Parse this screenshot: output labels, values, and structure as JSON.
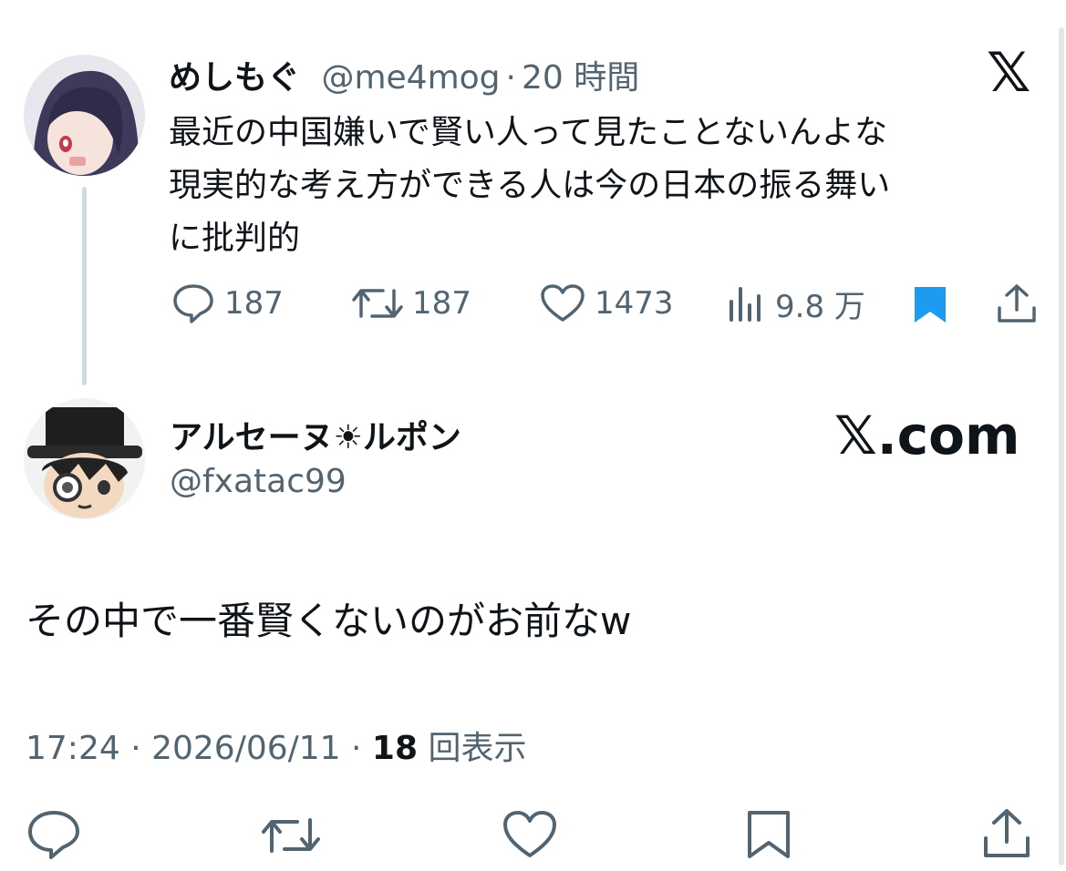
{
  "quoted": {
    "display_name": "めしもぐ",
    "handle": "@me4mog",
    "separator": "·",
    "time": "20 時間",
    "text": "最近の中国嫌いで賢い人って見たことないんよな\n現実的な考え方ができる人は今の日本の振る舞い\nに批判的",
    "actions": {
      "replies": "187",
      "reposts": "187",
      "likes": "1473",
      "views": "9.8 万"
    }
  },
  "reply": {
    "display_name": "アルセーヌ☀ルポン",
    "handle": "@fxatac99",
    "text": "その中で一番賢くないのがお前なw",
    "timestamp": "17:24 · 2026/06/11 · ",
    "views_count": "18",
    "views_label": " 回表示"
  },
  "branding": {
    "x_logo": "𝕏",
    "x_com": "𝕏.com"
  },
  "colors": {
    "text": "#0f1419",
    "muted": "#536471",
    "bookmark_active": "#1d9bf0",
    "thread_line": "#cfd9de"
  },
  "icons": [
    "reply-icon",
    "repost-icon",
    "like-icon",
    "views-icon",
    "bookmark-icon",
    "share-icon"
  ]
}
